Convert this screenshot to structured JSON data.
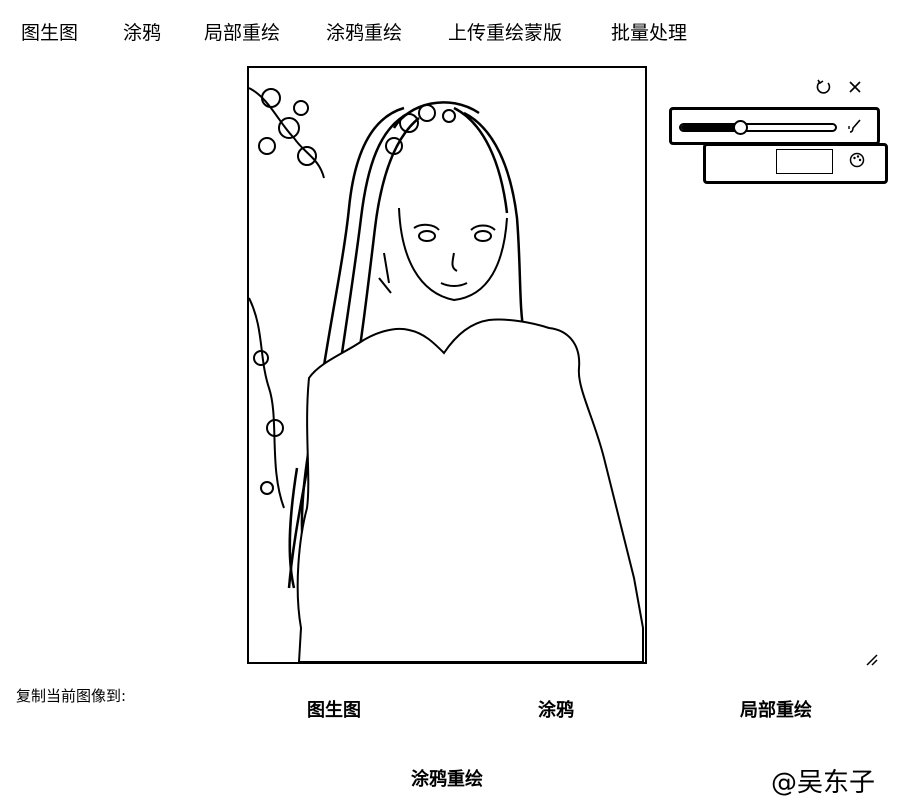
{
  "tabs": [
    {
      "label": "图生图"
    },
    {
      "label": "涂鸦"
    },
    {
      "label": "局部重绘"
    },
    {
      "label": "涂鸦重绘"
    },
    {
      "label": "上传重绘蒙版"
    },
    {
      "label": "批量处理"
    }
  ],
  "canvas": {
    "image_description_icon": "sketch-portrait-image"
  },
  "toolbar": {
    "undo_icon": "undo-icon",
    "close_icon": "close-icon",
    "brush_icon": "brush-icon",
    "palette_icon": "palette-icon"
  },
  "brush_size": {
    "level": 0.38
  },
  "color": {
    "current": "#ffffff"
  },
  "copy": {
    "label": "复制当前图像到:",
    "buttons": [
      {
        "label": "图生图"
      },
      {
        "label": "涂鸦"
      },
      {
        "label": "局部重绘"
      },
      {
        "label": "涂鸦重绘"
      }
    ]
  },
  "watermark": "@吴东子"
}
